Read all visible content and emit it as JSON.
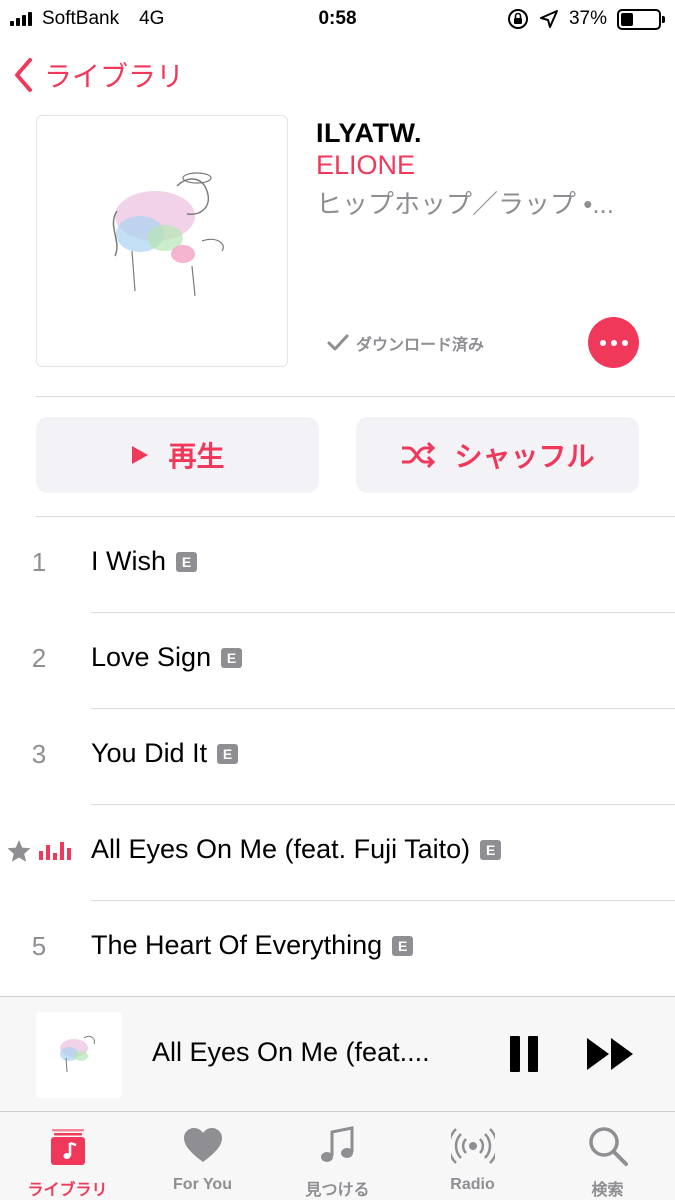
{
  "status_bar": {
    "carrier": "SoftBank",
    "network": "4G",
    "time": "0:58",
    "battery": "37%",
    "battery_level": 0.37
  },
  "nav": {
    "back_label": "ライブラリ"
  },
  "album": {
    "title": "ILYATW.",
    "artist": "ELIONE",
    "genre_line": "ヒップホップ／ラップ •...",
    "downloaded_label": "ダウンロード済み"
  },
  "actions": {
    "play_label": "再生",
    "shuffle_label": "シャッフル"
  },
  "tracks": [
    {
      "number": "1",
      "title": "I Wish",
      "explicit": "E"
    },
    {
      "number": "2",
      "title": "Love Sign",
      "explicit": "E"
    },
    {
      "number": "3",
      "title": "You Did It",
      "explicit": "E"
    },
    {
      "number": "",
      "title": "All Eyes On Me (feat. Fuji Taito)",
      "explicit": "E",
      "now_playing": true,
      "starred": true
    },
    {
      "number": "5",
      "title": "The Heart Of Everything",
      "explicit": "E"
    }
  ],
  "mini_player": {
    "title": "All Eyes On Me (feat...."
  },
  "tab_bar": {
    "tabs": [
      {
        "label": "ライブラリ",
        "icon": "library-icon",
        "active": true
      },
      {
        "label": "For You",
        "icon": "heart-icon",
        "active": false
      },
      {
        "label": "見つける",
        "icon": "music-note-icon",
        "active": false
      },
      {
        "label": "Radio",
        "icon": "radio-icon",
        "active": false
      },
      {
        "label": "検索",
        "icon": "search-icon",
        "active": false
      }
    ]
  },
  "colors": {
    "accent": "#f0395a",
    "secondary_text": "#8e8e93",
    "button_background": "#f2f2f7"
  }
}
